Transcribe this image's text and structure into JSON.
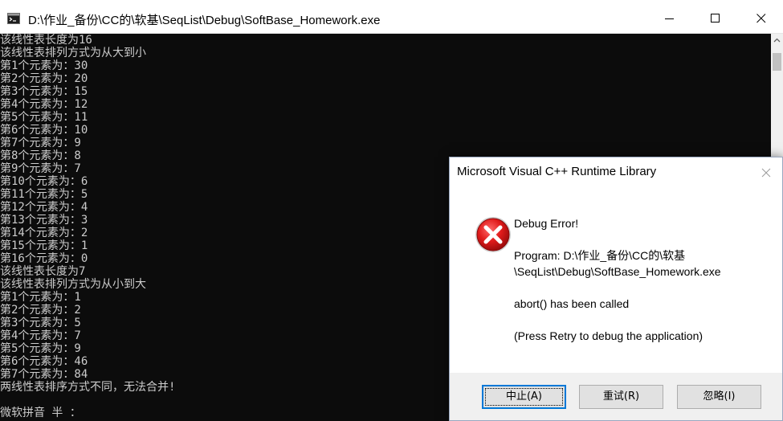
{
  "window": {
    "title": "D:\\作业_备份\\CC的\\软基\\SeqList\\Debug\\SoftBase_Homework.exe",
    "top_fragment": "Homework"
  },
  "console": {
    "lines": [
      "该线性表长度为16",
      "该线性表排列方式为从大到小",
      "第1个元素为：30",
      "第2个元素为：20",
      "第3个元素为：15",
      "第4个元素为：12",
      "第5个元素为：11",
      "第6个元素为：10",
      "第7个元素为：9",
      "第8个元素为：8",
      "第9个元素为：7",
      "第10个元素为：6",
      "第11个元素为：5",
      "第12个元素为：4",
      "第13个元素为：3",
      "第14个元素为：2",
      "第15个元素为：1",
      "第16个元素为：0",
      "该线性表长度为7",
      "该线性表排列方式为从小到大",
      "第1个元素为：1",
      "第2个元素为：2",
      "第3个元素为：5",
      "第4个元素为：7",
      "第5个元素为：9",
      "第6个元素为：46",
      "第7个元素为：84",
      "两线性表排序方式不同，无法合并!"
    ],
    "ime_status": "微软拼音 半 ："
  },
  "dialog": {
    "title": "Microsoft Visual C++ Runtime Library",
    "heading": "Debug Error!",
    "program_line1": "Program: D:\\作业_备份\\CC的\\软基",
    "program_line2": "\\SeqList\\Debug\\SoftBase_Homework.exe",
    "abort_text": "abort() has been called",
    "retry_hint": "(Press Retry to debug the application)",
    "buttons": {
      "abort": "中止(A)",
      "retry": "重试(R)",
      "ignore": "忽略(I)"
    }
  },
  "colors": {
    "console_bg": "#0c0c0c",
    "console_text": "#cccccc",
    "error_red": "#e81123",
    "focus_blue": "#0078d7"
  }
}
